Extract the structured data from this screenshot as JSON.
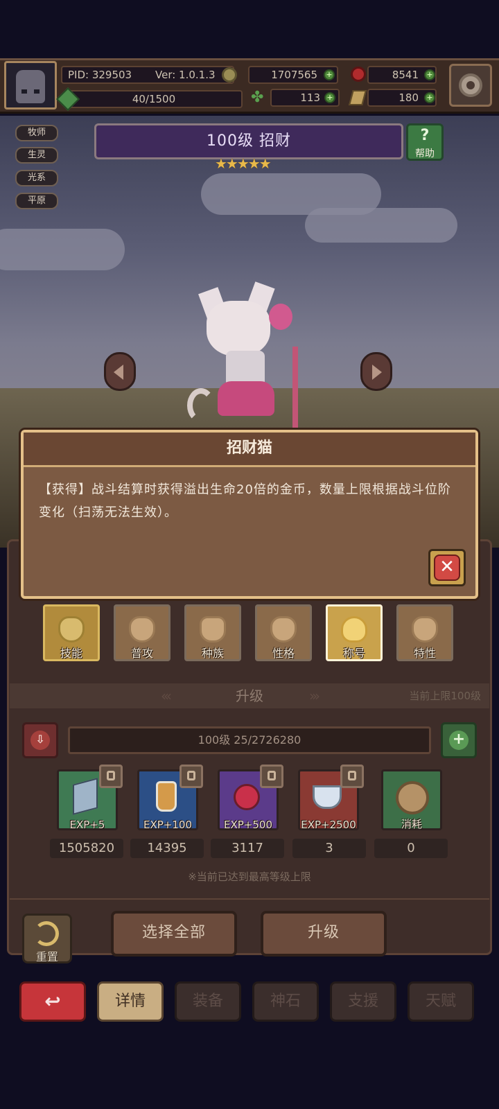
{
  "header": {
    "pid": "PID: 329503",
    "version": "Ver: 1.0.1.3",
    "energy": "40/1500",
    "gold": "1707565",
    "gems": "8541",
    "clover": "113",
    "tickets": "180"
  },
  "tags": [
    "牧师",
    "生灵",
    "光系",
    "平原"
  ],
  "hero": {
    "title": "100级  招财",
    "stars": "★★★★★",
    "help_label": "帮助"
  },
  "dialog": {
    "title": "招财猫",
    "body": "【获得】战斗结算时获得溢出生命20倍的金币，数量上限根据战斗位阶变化（扫荡无法生效）。",
    "close_glyph": "✕"
  },
  "skill_tabs": [
    {
      "label": "技能"
    },
    {
      "label": "普攻"
    },
    {
      "label": "种族"
    },
    {
      "label": "性格"
    },
    {
      "label": "称号"
    },
    {
      "label": "特性"
    }
  ],
  "upgrade": {
    "title": "升级",
    "cap": "当前上限100级",
    "level_bar": "100级  25/2726280",
    "items": [
      {
        "label": "EXP+5",
        "count": "1505820"
      },
      {
        "label": "EXP+100",
        "count": "14395"
      },
      {
        "label": "EXP+500",
        "count": "3117"
      },
      {
        "label": "EXP+2500",
        "count": "3"
      },
      {
        "label": "消耗",
        "count": "0"
      }
    ],
    "note": "※当前已达到最高等级上限",
    "reset_label": "重置",
    "select_all": "选择全部",
    "upgrade_button": "升级"
  },
  "bottom_nav": [
    "详情",
    "装备",
    "神石",
    "支援",
    "天赋"
  ],
  "colors": {
    "gold": "#e8b94a",
    "close_red": "#d24a44",
    "title_purple": "#3f2a5b"
  }
}
